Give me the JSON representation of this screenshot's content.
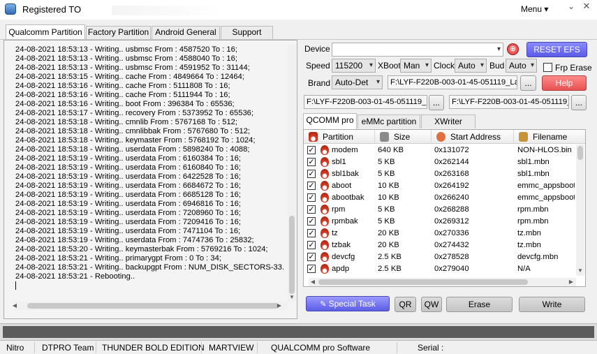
{
  "window": {
    "title": "Registered TO",
    "menu_label": "Menu ▾",
    "minimize": "⌄",
    "close": "✕"
  },
  "tabs": [
    "Qualcomm Partition",
    "Factory Partition",
    "Android General",
    "Support"
  ],
  "log_lines": [
    "24-08-2021 18:53:13 - Writing.. usbmsc From : 4587520 To : 16;",
    "24-08-2021 18:53:13 - Writing.. usbmsc From : 4588040 To : 16;",
    "24-08-2021 18:53:13 - Writing.. usbmsc From : 4591952 To : 31144;",
    "24-08-2021 18:53:15 - Writing.. cache From : 4849664 To : 12464;",
    "24-08-2021 18:53:16 - Writing.. cache From : 5111808 To : 16;",
    "24-08-2021 18:53:16 - Writing.. cache From : 5111944 To : 16;",
    "24-08-2021 18:53:16 - Writing.. boot From : 396384 To : 65536;",
    "24-08-2021 18:53:17 - Writing.. recovery From : 5373952 To : 65536;",
    "24-08-2021 18:53:18 - Writing.. cmnlib From : 5767168 To : 512;",
    "24-08-2021 18:53:18 - Writing.. cmnlibbak From : 5767680 To : 512;",
    "24-08-2021 18:53:18 - Writing.. keymaster From : 5768192 To : 1024;",
    "24-08-2021 18:53:18 - Writing.. userdata From : 5898240 To : 4088;",
    "24-08-2021 18:53:19 - Writing.. userdata From : 6160384 To : 16;",
    "24-08-2021 18:53:19 - Writing.. userdata From : 6160840 To : 16;",
    "24-08-2021 18:53:19 - Writing.. userdata From : 6422528 To : 16;",
    "24-08-2021 18:53:19 - Writing.. userdata From : 6684672 To : 16;",
    "24-08-2021 18:53:19 - Writing.. userdata From : 6685128 To : 16;",
    "24-08-2021 18:53:19 - Writing.. userdata From : 6946816 To : 16;",
    "24-08-2021 18:53:19 - Writing.. userdata From : 7208960 To : 16;",
    "24-08-2021 18:53:19 - Writing.. userdata From : 7209416 To : 16;",
    "24-08-2021 18:53:19 - Writing.. userdata From : 7471104 To : 16;",
    "24-08-2021 18:53:19 - Writing.. userdata From : 7474736 To : 25832;",
    "24-08-2021 18:53:20 - Writing.. keymasterbak From : 5769216 To : 1024;",
    "24-08-2021 18:53:21 - Writing.. primarygpt From : 0 To : 34;",
    "24-08-2021 18:53:21 - Writing.. backupgpt From : NUM_DISK_SECTORS-33.",
    "24-08-2021 18:53:21 - Rebooting.."
  ],
  "controls": {
    "device_label": "Device",
    "device_value": "",
    "reset_label": "RESET EFS",
    "speed_label": "Speed",
    "speed_value": "115200",
    "xboot_label": "XBoot",
    "xboot_value": "Man",
    "clock_label": "Clock",
    "clock_value": "Auto",
    "bud_label": "Bud",
    "bud_value": "Auto",
    "frp_label": "Frp Erase",
    "brand_label": "Brand",
    "brand_value": "Auto-Det",
    "file1": "F:\\LYF-F220B-003-01-45-051119_Late",
    "file2": "F:\\LYF-F220B-003-01-45-051119_La",
    "file3": "F:\\LYF-F220B-003-01-45-051119_L",
    "browse": "...",
    "help_label": "Help"
  },
  "ptabs": [
    "QCOMM pro",
    "eMMc partition",
    "XWriter"
  ],
  "grid": {
    "headers": [
      "Partition",
      "Size",
      "Start Address",
      "Filename"
    ],
    "rows": [
      {
        "name": "modem",
        "size": "640 KB",
        "addr": "0x131072",
        "file": "NON-HLOS.bin"
      },
      {
        "name": "sbl1",
        "size": "5 KB",
        "addr": "0x262144",
        "file": "sbl1.mbn"
      },
      {
        "name": "sbl1bak",
        "size": "5 KB",
        "addr": "0x263168",
        "file": "sbl1.mbn"
      },
      {
        "name": "aboot",
        "size": "10 KB",
        "addr": "0x264192",
        "file": "emmc_appsboot"
      },
      {
        "name": "abootbak",
        "size": "10 KB",
        "addr": "0x266240",
        "file": "emmc_appsboot"
      },
      {
        "name": "rpm",
        "size": "5 KB",
        "addr": "0x268288",
        "file": "rpm.mbn"
      },
      {
        "name": "rpmbak",
        "size": "5 KB",
        "addr": "0x269312",
        "file": "rpm.mbn"
      },
      {
        "name": "tz",
        "size": "20 KB",
        "addr": "0x270336",
        "file": "tz.mbn"
      },
      {
        "name": "tzbak",
        "size": "20 KB",
        "addr": "0x274432",
        "file": "tz.mbn"
      },
      {
        "name": "devcfg",
        "size": "2.5 KB",
        "addr": "0x278528",
        "file": "devcfg.mbn"
      },
      {
        "name": "apdp",
        "size": "2.5 KB",
        "addr": "0x279040",
        "file": "N/A"
      }
    ]
  },
  "buttons": {
    "special": "Special Task",
    "qr": "QR",
    "qw": "QW",
    "erase": "Erase",
    "write": "Write"
  },
  "status": [
    "Nitro",
    "DTPRO Team",
    "THUNDER BOLD EDITION",
    "MARTVIEW",
    "QUALCOMM pro Software",
    "Serial :"
  ],
  "colors": {
    "accent_blue": "#5c5ce6",
    "accent_red": "#e65252"
  }
}
